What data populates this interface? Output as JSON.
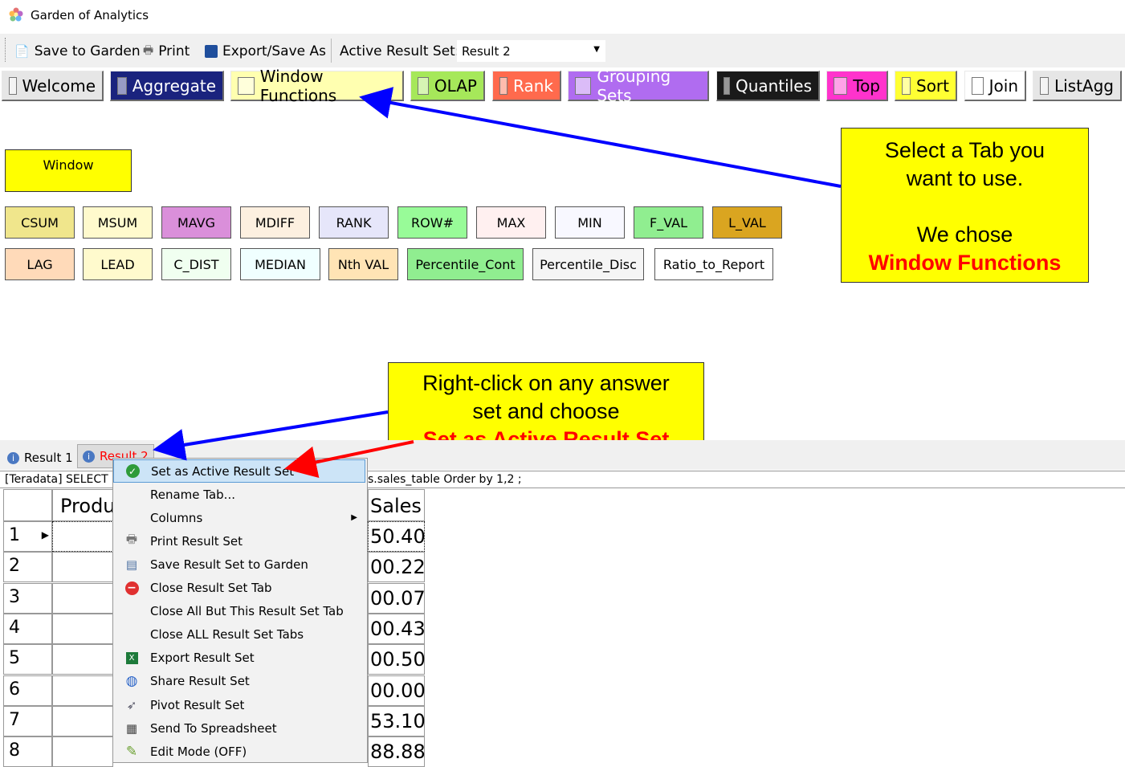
{
  "window": {
    "title": "Garden of Analytics"
  },
  "toolbar": {
    "save": "Save to Garden",
    "print": "Print",
    "export": "Export/Save As",
    "active_label": "Active Result Set:",
    "active_value": "Result 2"
  },
  "tabs": [
    {
      "label": "Welcome",
      "bg": "#e6e6e6",
      "color": "#000000"
    },
    {
      "label": "Aggregate",
      "bg": "#1a237e",
      "color": "#ffffff"
    },
    {
      "label": "Window Functions",
      "bg": "#ffffb0",
      "color": "#000000"
    },
    {
      "label": "OLAP",
      "bg": "#a6e85a",
      "color": "#000000"
    },
    {
      "label": "Rank",
      "bg": "#ff6a4d",
      "color": "#ffffff"
    },
    {
      "label": "Grouping Sets",
      "bg": "#b06cf0",
      "color": "#ffffff"
    },
    {
      "label": "Quantiles",
      "bg": "#1a1a1a",
      "color": "#ffffff"
    },
    {
      "label": "Top",
      "bg": "#ff33cc",
      "color": "#000000"
    },
    {
      "label": "Sort",
      "bg": "#ffff33",
      "color": "#000000"
    },
    {
      "label": "Join",
      "bg": "#ffffff",
      "color": "#000000"
    },
    {
      "label": "ListAgg",
      "bg": "#e6e6e6",
      "color": "#000000"
    }
  ],
  "window_button": "Window",
  "functions_row1": [
    {
      "label": "CSUM",
      "bg": "#f0e68c"
    },
    {
      "label": "MSUM",
      "bg": "#fffacd"
    },
    {
      "label": "MAVG",
      "bg": "#da8fda"
    },
    {
      "label": "MDIFF",
      "bg": "#fdf0e0"
    },
    {
      "label": "RANK",
      "bg": "#e6e6fa"
    },
    {
      "label": "ROW#",
      "bg": "#98fb98"
    },
    {
      "label": "MAX",
      "bg": "#fff0f0"
    },
    {
      "label": "MIN",
      "bg": "#f8f8ff"
    },
    {
      "label": "F_VAL",
      "bg": "#90ee90"
    },
    {
      "label": "L_VAL",
      "bg": "#daa520"
    }
  ],
  "functions_row2": [
    {
      "label": "LAG",
      "bg": "#ffdab9"
    },
    {
      "label": "LEAD",
      "bg": "#fffacd"
    },
    {
      "label": "C_DIST",
      "bg": "#f0fff0"
    },
    {
      "label": "MEDIAN",
      "bg": "#f0ffff"
    },
    {
      "label": "Nth VAL",
      "bg": "#ffe4b5"
    },
    {
      "label": "Percentile_Cont",
      "bg": "#90ee90"
    },
    {
      "label": "Percentile_Disc",
      "bg": "#f5f5f5"
    },
    {
      "label": "Ratio_to_Report",
      "bg": "#ffffff"
    }
  ],
  "callout1": {
    "line1": "Select a Tab you",
    "line2": "want to use.",
    "line3": "We chose",
    "line4": "Window Functions"
  },
  "callout2": {
    "line1": "Right-click on any answer",
    "line2": "set and choose",
    "line3": "Set as Active Result Set"
  },
  "result_tabs": {
    "tab1": "Result 1",
    "tab2": "Result 2"
  },
  "sql": {
    "prefix": "[Teradata] SELECT F",
    "suffix": "s.sales_table Order by 1,2 ;"
  },
  "grid": {
    "col_product": "Produ",
    "col_sales": "Sales",
    "rows": [
      "1",
      "2",
      "3",
      "4",
      "5",
      "6",
      "7",
      "8"
    ],
    "sales": [
      "50.40",
      "00.22",
      "00.07",
      "00.43",
      "00.50",
      "00.00",
      "53.10",
      "88.88"
    ]
  },
  "context_menu": [
    {
      "label": "Set as Active Result Set",
      "icon": "check-circle-icon"
    },
    {
      "label": "Rename Tab...",
      "icon": ""
    },
    {
      "label": "Columns",
      "icon": "",
      "submenu": true
    },
    {
      "label": "Print Result Set",
      "icon": "printer-icon"
    },
    {
      "label": "Save Result Set to Garden",
      "icon": "save-garden-icon"
    },
    {
      "label": "Close Result Set Tab",
      "icon": "close-circle-icon"
    },
    {
      "label": "Close All But This Result Set Tab",
      "icon": ""
    },
    {
      "label": "Close ALL Result Set Tabs",
      "icon": ""
    },
    {
      "label": "Export Result Set",
      "icon": "excel-icon"
    },
    {
      "label": "Share Result Set",
      "icon": "globe-icon"
    },
    {
      "label": "Pivot Result Set",
      "icon": "pivot-icon"
    },
    {
      "label": "Send To Spreadsheet",
      "icon": "spreadsheet-icon"
    },
    {
      "label": "Edit Mode (OFF)",
      "icon": "pencil-icon"
    }
  ]
}
